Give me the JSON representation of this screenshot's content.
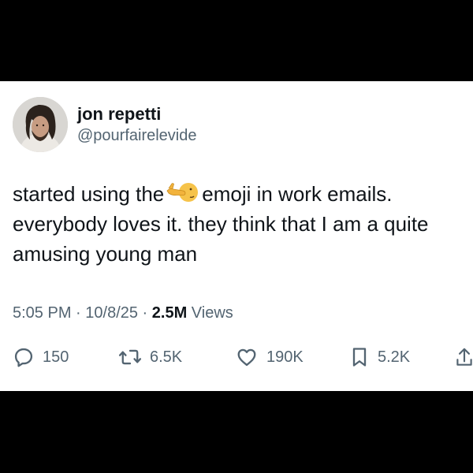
{
  "tweet": {
    "author": {
      "display_name": "jon repetti",
      "handle": "@pourfairelevide",
      "avatar": "profile-photo"
    },
    "text_lines": {
      "line1_before_emoji": "started using the",
      "emoji": "face-with-hand-over-mouth-peeking-emoji",
      "line1_after_emoji": "emoji in work emails.",
      "line2": "everybody loves it. they think that I am a quite",
      "line3": "amusing young man"
    },
    "meta": {
      "time": "5:05 PM",
      "separator1": " · ",
      "date": "10/8/25",
      "separator2": " · ",
      "views_count": "2.5M",
      "views_label": " Views"
    },
    "actions": {
      "replies": "150",
      "reposts": "6.5K",
      "likes": "190K",
      "bookmarks": "5.2K",
      "icons": [
        "reply-icon",
        "repost-icon",
        "like-icon",
        "bookmark-icon",
        "share-icon"
      ]
    }
  },
  "colors": {
    "background": "#000000",
    "card": "#ffffff",
    "primary_text": "#0f1419",
    "secondary_text": "#536471"
  }
}
